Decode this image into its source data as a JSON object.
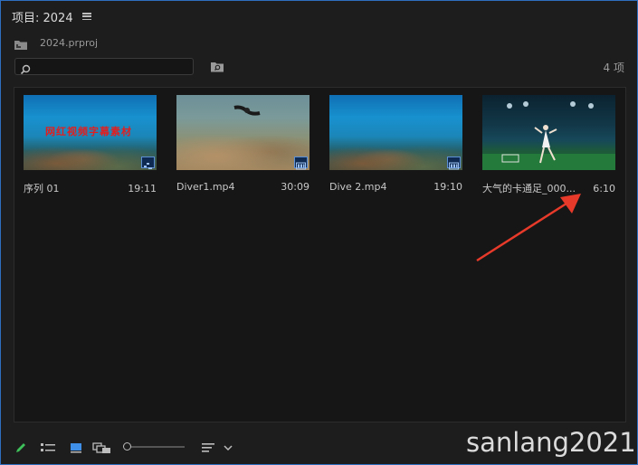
{
  "panel": {
    "title": "项目: 2024",
    "menu_icon": "hamburger-menu-icon"
  },
  "project_file": {
    "icon": "bin-folder-icon",
    "name": "2024.prproj"
  },
  "search": {
    "icon": "search-icon",
    "value": "",
    "placeholder": ""
  },
  "find_button": {
    "icon": "find-bin-icon"
  },
  "item_count": "4 项",
  "items": [
    {
      "name": "序列 01",
      "duration": "19:11",
      "badge": "sequence-icon",
      "overlay_text": "网红视频字幕素材"
    },
    {
      "name": "Diver1.mp4",
      "duration": "30:09",
      "badge": "video-clip-icon"
    },
    {
      "name": "Dive 2.mp4",
      "duration": "19:10",
      "badge": "video-clip-icon"
    },
    {
      "name": "大气的卡通足_000...",
      "duration": "6:10",
      "badge": ""
    }
  ],
  "footer": {
    "pencil_icon": "pencil-icon",
    "list_view_icon": "list-view-icon",
    "icon_view_icon": "icon-view-icon",
    "freeform_view_icon": "freeform-view-icon",
    "zoom_slider_icon": "zoom-slider",
    "sort_icon": "sort-icon",
    "dropdown_icon": "chevron-down-icon"
  },
  "annotation": {
    "arrow_color": "#e83a2a"
  },
  "watermark": "sanlang2021",
  "colors": {
    "accent": "#2f6fbf",
    "background": "#1d1d1d",
    "grid_bg": "#161616"
  }
}
